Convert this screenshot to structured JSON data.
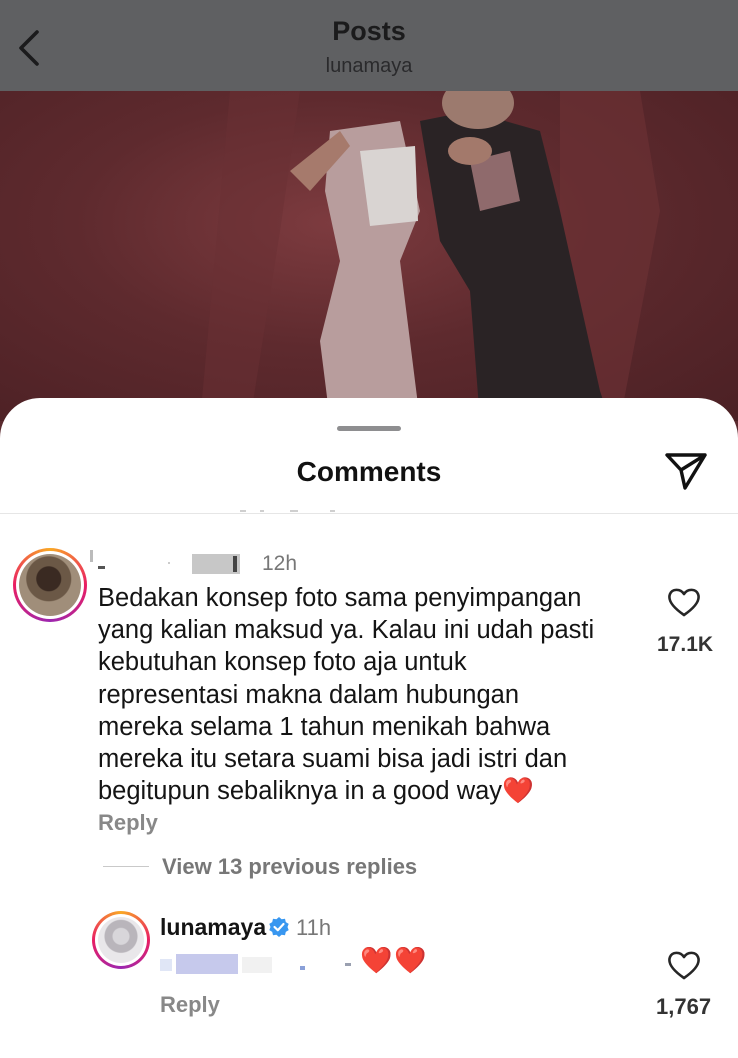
{
  "header": {
    "title": "Posts",
    "username": "lunamaya"
  },
  "sheet": {
    "title": "Comments"
  },
  "comments": [
    {
      "time": "12h",
      "text": "Bedakan konsep foto sama penyimpangan\nyang kalian maksud ya. Kalau ini udah pasti\nkebutuhan konsep foto aja untuk\nrepresentasi makna dalam hubungan\nmereka selama 1 tahun menikah bahwa\nmereka itu setara suami bisa jadi istri dan\nbegitupun sebaliknya in a good way",
      "emoji": "❤️",
      "likes": "17.1K",
      "reply_label": "Reply",
      "view_replies": "View 13 previous replies"
    }
  ],
  "reply": {
    "username": "lunamaya",
    "time": "11h",
    "emoji": "❤️❤️",
    "likes": "1,767",
    "reply_label": "Reply"
  },
  "colors": {
    "header_bg": "#5f6062",
    "photo_bg": "#5e2a2e",
    "verified": "#3897f0",
    "heart_outline": "#262626"
  },
  "icons": {
    "back": "chevron-left-icon",
    "share": "send-icon",
    "like": "heart-outline-icon",
    "verified": "verified-badge-icon"
  }
}
